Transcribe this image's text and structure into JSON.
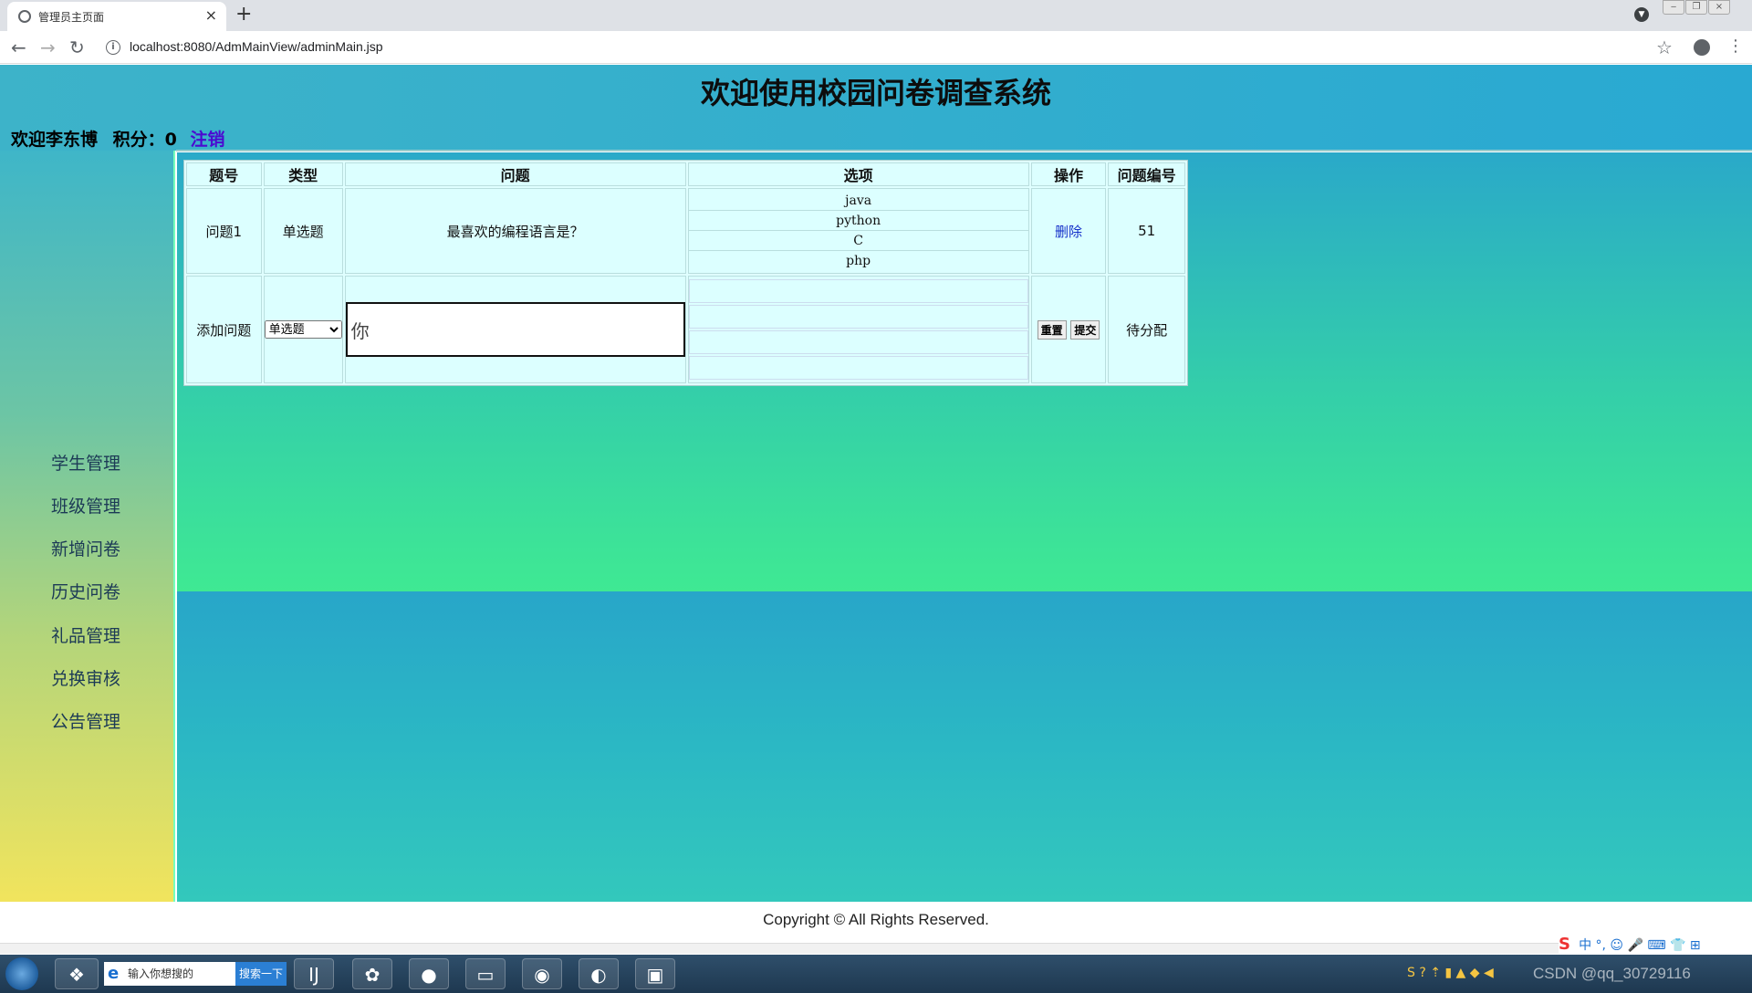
{
  "browser": {
    "tab_title": "管理员主页面",
    "tab_close": "×",
    "new_tab": "+",
    "url": "localhost:8080/AdmMainView/adminMain.jsp",
    "back": "←",
    "forward": "→",
    "reload": "↻",
    "star": "☆",
    "menu": "⋮",
    "window_buttons": [
      "‒",
      "❐",
      "×"
    ]
  },
  "header": {
    "title": "欢迎使用校园问卷调查系统",
    "welcome": "欢迎李东博",
    "points_label": "积分：0",
    "logout": "注销"
  },
  "sidebar": {
    "items": [
      {
        "label": "学生管理"
      },
      {
        "label": "班级管理"
      },
      {
        "label": "新增问卷"
      },
      {
        "label": "历史问卷"
      },
      {
        "label": "礼品管理"
      },
      {
        "label": "兑换审核"
      },
      {
        "label": "公告管理"
      }
    ]
  },
  "table": {
    "headers": [
      "题号",
      "类型",
      "问题",
      "选项",
      "操作",
      "问题编号"
    ],
    "rows": [
      {
        "number": "问题1",
        "type": "单选题",
        "question": "最喜欢的编程语言是？",
        "options": [
          "java",
          "python",
          "C",
          "php"
        ],
        "action": "删除",
        "id": "51"
      }
    ],
    "add_row": {
      "label": "添加问题",
      "type_selected": "单选题",
      "question_value": "你",
      "reset": "重置",
      "submit": "提交",
      "id_status": "待分配"
    }
  },
  "footer": {
    "copyright": "Copyright © All Rights Reserved."
  },
  "taskbar": {
    "search_placeholder": "输入你想搜的",
    "search_button": "搜索一下",
    "watermark": "CSDN @qq_30729116",
    "ime": "中 °, ☺ 🎤 ⌨ 👕 ⊞"
  },
  "colors": {
    "banner": "#2aa9d2",
    "table_bg": "#dcffff",
    "link": "#1530c9",
    "logout": "#4b0ad1"
  }
}
